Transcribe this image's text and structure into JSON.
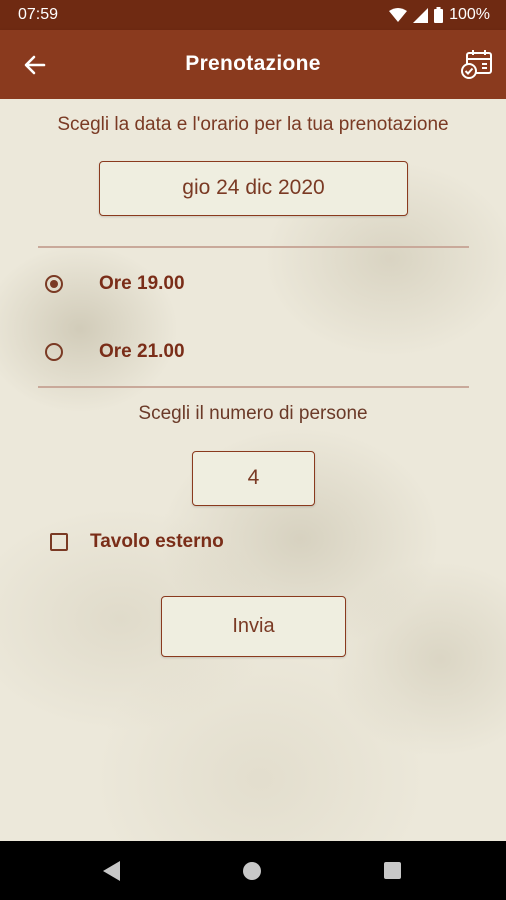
{
  "status_bar": {
    "time": "07:59",
    "battery": "100%"
  },
  "app_bar": {
    "title": "Prenotazione"
  },
  "date_section": {
    "prompt": "Scegli la data e l'orario per la tua prenotazione",
    "selected_date": "gio 24 dic 2020"
  },
  "time_options": [
    {
      "label": "Ore 19.00",
      "selected": true
    },
    {
      "label": "Ore 21.00",
      "selected": false
    }
  ],
  "people_section": {
    "prompt": "Scegli il numero di persone",
    "count": "4"
  },
  "outdoor_table": {
    "label": "Tavolo esterno",
    "checked": false
  },
  "submit_label": "Invia",
  "colors": {
    "primary": "#8a3a1e",
    "status_bar": "#6f2a12",
    "text": "#7a3a24"
  }
}
